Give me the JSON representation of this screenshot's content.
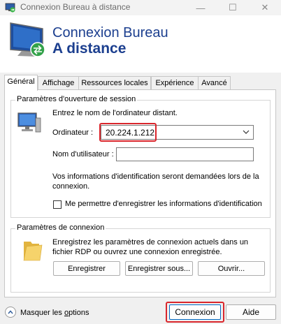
{
  "window": {
    "title": "Connexion Bureau à distance",
    "minimize_glyph": "—",
    "maximize_glyph": "☐",
    "close_glyph": "✕"
  },
  "header": {
    "line1": "Connexion Bureau",
    "line2": "A distance"
  },
  "tabs": [
    {
      "label": "Général",
      "active": true
    },
    {
      "label": "Affichage",
      "active": false
    },
    {
      "label": "Ressources locales",
      "active": false
    },
    {
      "label": "Expérience",
      "active": false
    },
    {
      "label": "Avancé",
      "active": false
    }
  ],
  "session_group": {
    "title": "Paramètres d'ouverture de session",
    "instruction": "Entrez le nom de l'ordinateur distant.",
    "computer_label": "Ordinateur :",
    "computer_value": "20.224.1.212",
    "username_label": "Nom d'utilisateur :",
    "username_value": "",
    "info_line1": "Vos informations d'identification seront demandées lors de la",
    "info_line2": "connexion.",
    "remember_checkbox_label": "Me permettre d'enregistrer les informations d'identification",
    "remember_checked": false
  },
  "connection_group": {
    "title": "Paramètres de connexion",
    "description_line1": "Enregistrez les paramètres de connexion actuels dans un",
    "description_line2": "fichier RDP ou ouvrez une connexion enregistrée.",
    "save_button": "Enregistrer",
    "save_as_button": "Enregistrer sous...",
    "open_button": "Ouvrir..."
  },
  "footer": {
    "hide_options_prefix": "Masquer les ",
    "hide_options_underlined": "o",
    "hide_options_suffix": "ptions",
    "connect_button": "Connexion",
    "help_button": "Aide"
  },
  "colors": {
    "header_text": "#1c3f8f",
    "highlight": "#d9262c"
  }
}
